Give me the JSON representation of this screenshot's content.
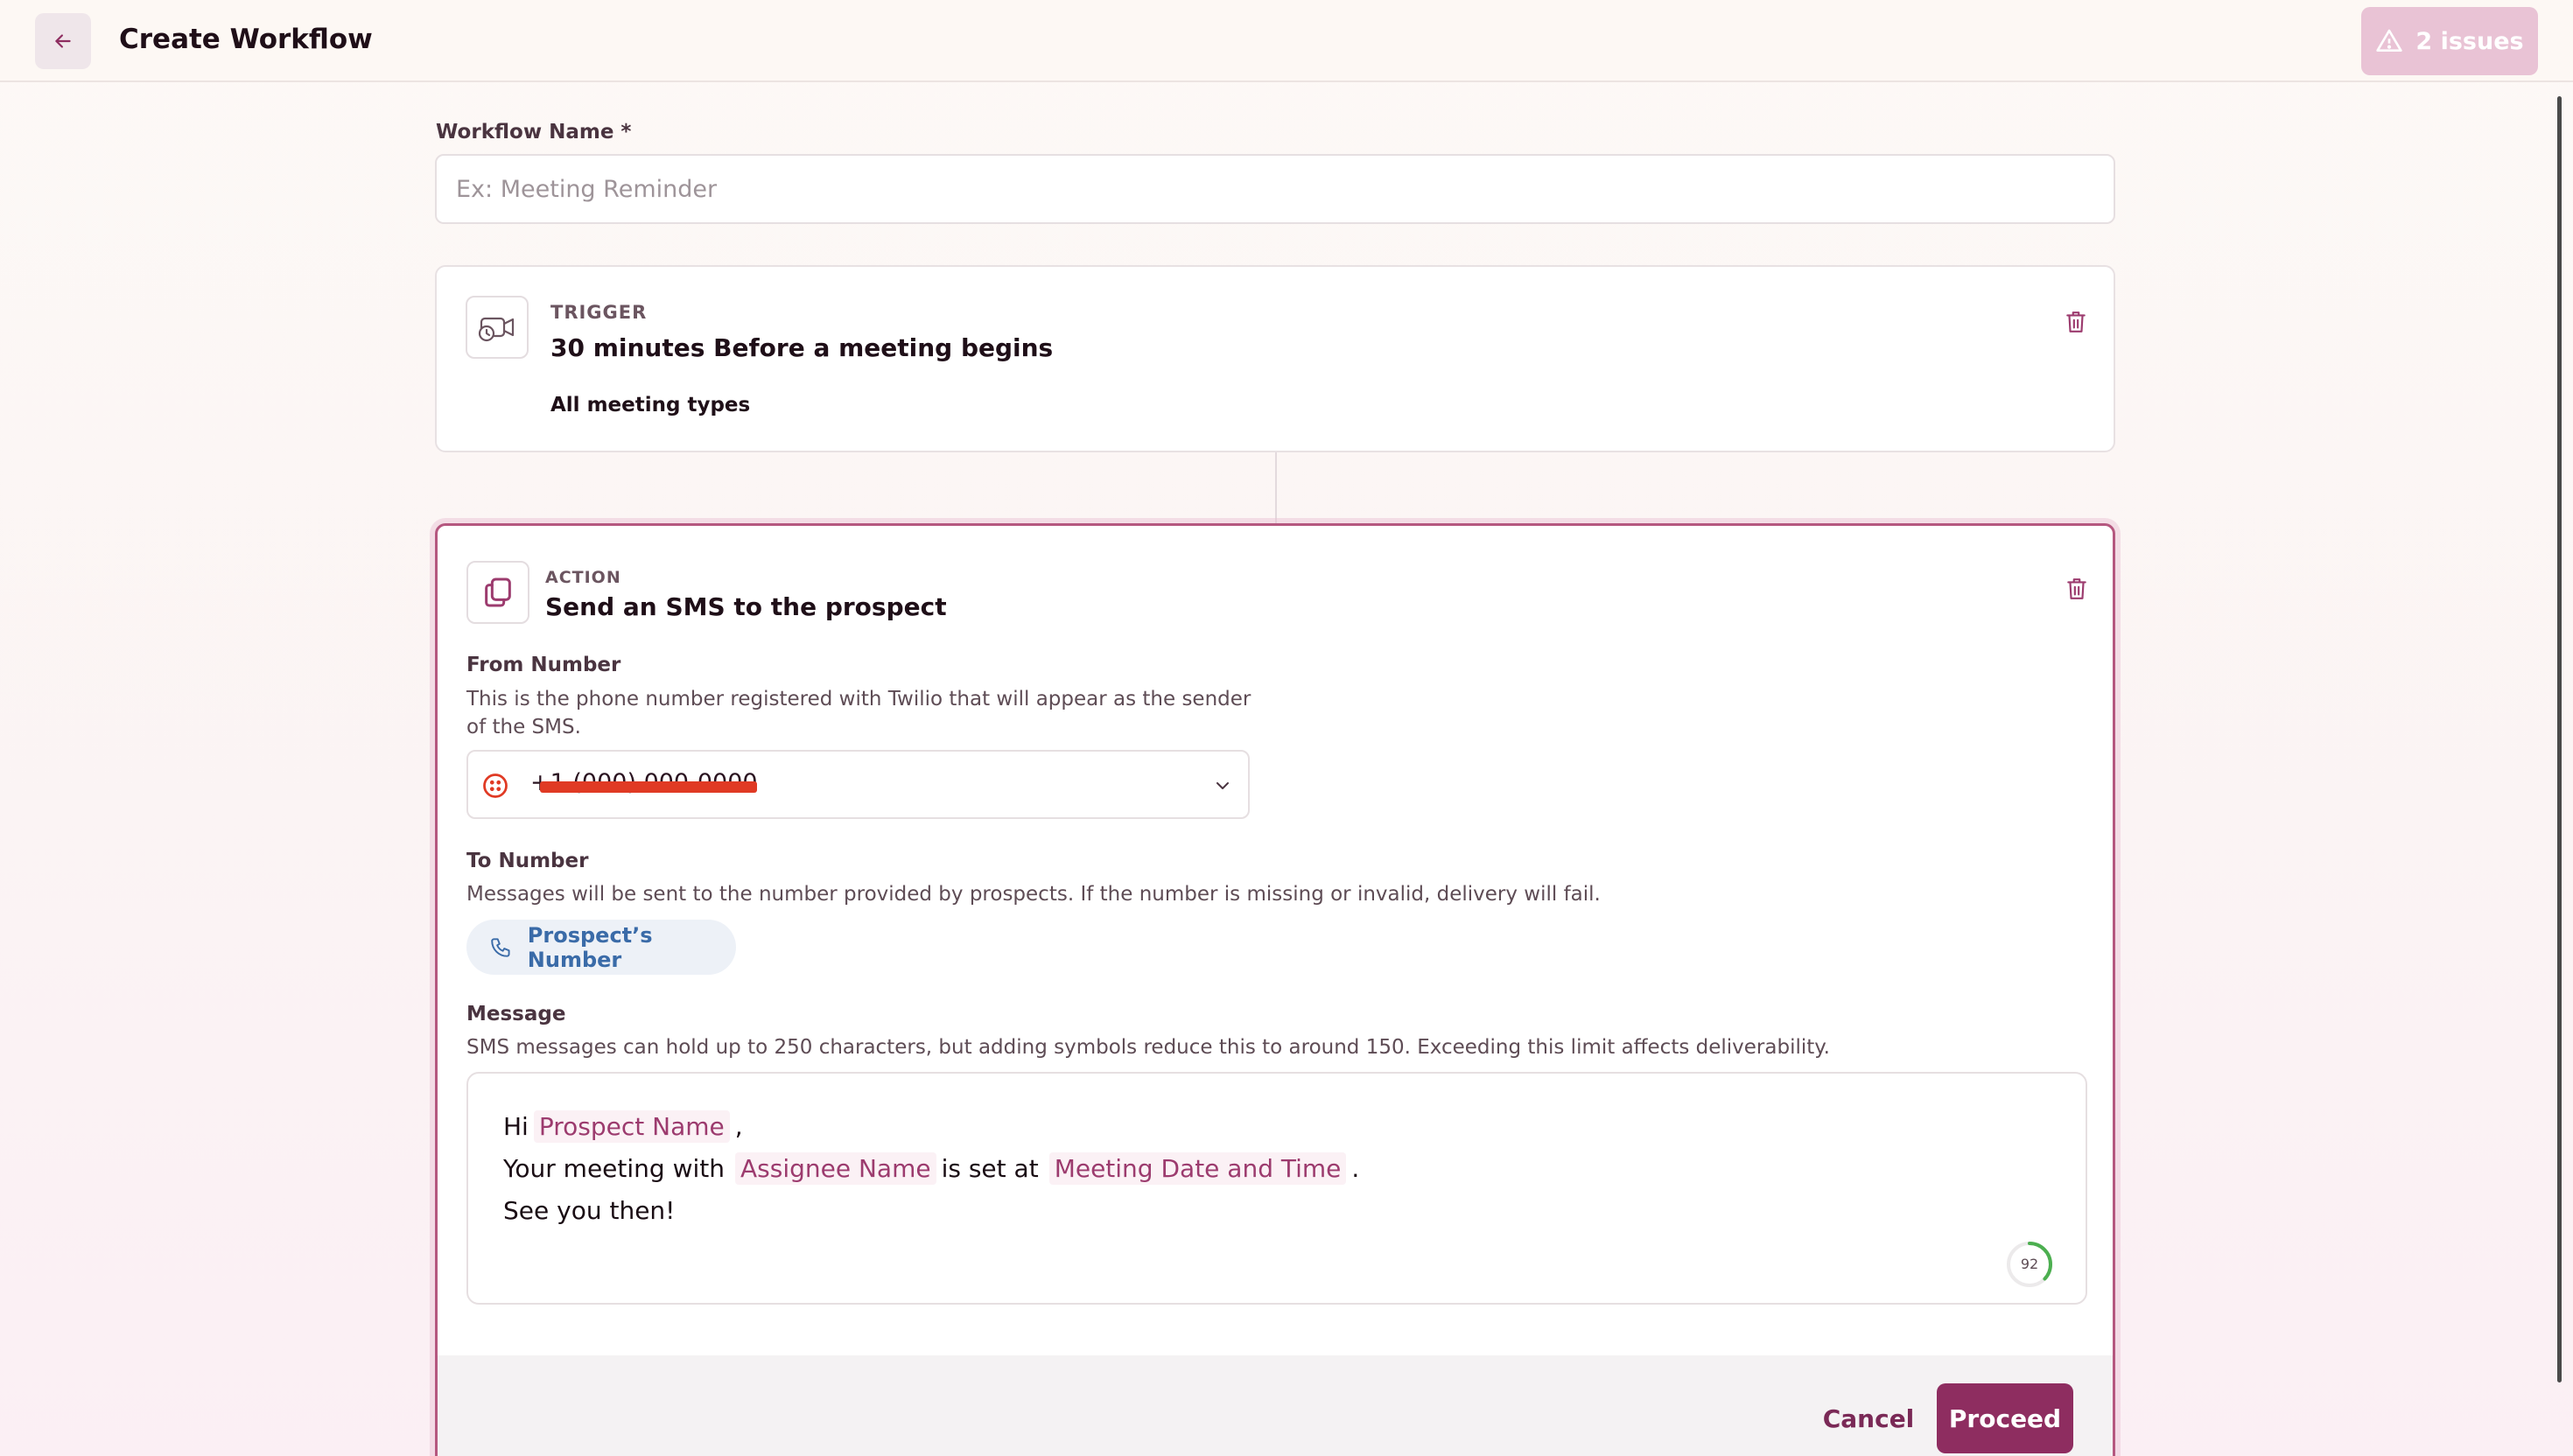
{
  "header": {
    "title": "Create Workflow",
    "issues_label": "2 issues"
  },
  "workflow_name": {
    "label": "Workflow Name *",
    "value": "",
    "placeholder": "Ex: Meeting Reminder"
  },
  "trigger": {
    "eyebrow": "TRIGGER",
    "title": "30 minutes Before a meeting begins",
    "subtitle": "All meeting types"
  },
  "action": {
    "eyebrow": "ACTION",
    "title": "Send an SMS to the prospect",
    "from_number": {
      "label": "From Number",
      "help_line1": "This is the phone number registered with Twilio that will appear as the sender",
      "help_line2": "of the SMS.",
      "value": "+1 (000) 000-0000",
      "value_redacted": true
    },
    "to_number": {
      "label": "To Number",
      "help": "Messages will be sent to the number provided by prospects. If the number is missing or invalid, delivery will fail.",
      "chip_label": "Prospect’s Number"
    },
    "message": {
      "label": "Message",
      "help": "SMS messages can hold up to 250 characters, but adding symbols reduce this to around 150. Exceeding this limit affects deliverability.",
      "line1_prefix": "Hi",
      "line1_token": "Prospect Name",
      "line1_suffix": ",",
      "line2_prefix": "Your meeting with",
      "line2_token1": "Assignee Name",
      "line2_middle": "is set at",
      "line2_token2": "Meeting Date and Time",
      "line2_suffix": ".",
      "line3": "See you then!",
      "char_counter": "92",
      "char_counter_fraction": 0.37
    },
    "cancel_label": "Cancel",
    "proceed_label": "Proceed"
  },
  "colors": {
    "brand": "#8e2d60",
    "issues_bg": "#e9c3d5",
    "token_text": "#9c3b6e",
    "chip_text": "#3a6ba8",
    "counter_ring": "#4caf50",
    "redaction": "#e03a24"
  },
  "icons": [
    "back-arrow-icon",
    "warning-triangle-icon",
    "video-clock-icon",
    "trash-icon",
    "sms-copy-icon",
    "twilio-icon",
    "chevron-down-icon",
    "phone-icon"
  ]
}
